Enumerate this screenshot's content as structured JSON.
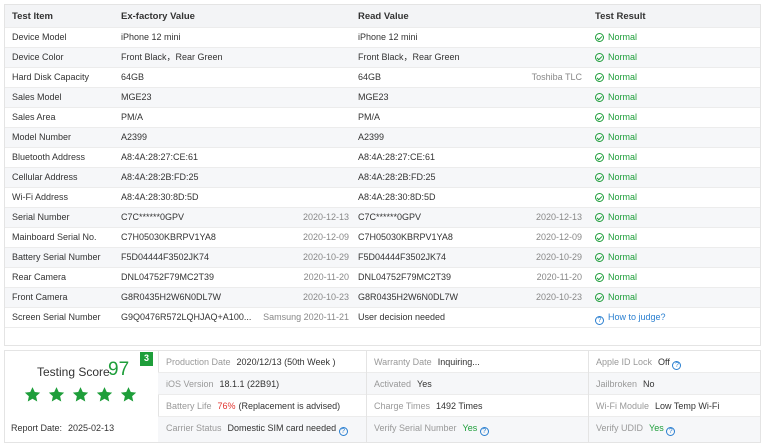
{
  "table": {
    "headers": [
      "Test Item",
      "Ex-factory Value",
      "Read Value",
      "Test Result"
    ],
    "rows": [
      {
        "item": "Device Model",
        "factory": "iPhone 12 mini",
        "factory_sub": "",
        "read": "iPhone 12 mini",
        "read_sub": "",
        "result": "Normal"
      },
      {
        "item": "Device Color",
        "factory": "Front Black，Rear Green",
        "factory_sub": "",
        "read": "Front Black，Rear Green",
        "read_sub": "",
        "result": "Normal"
      },
      {
        "item": "Hard Disk Capacity",
        "factory": "64GB",
        "factory_sub": "",
        "read": "64GB",
        "read_sub": "Toshiba TLC",
        "result": "Normal"
      },
      {
        "item": "Sales Model",
        "factory": "MGE23",
        "factory_sub": "",
        "read": "MGE23",
        "read_sub": "",
        "result": "Normal"
      },
      {
        "item": "Sales Area",
        "factory": "PM/A",
        "factory_sub": "",
        "read": "PM/A",
        "read_sub": "",
        "result": "Normal"
      },
      {
        "item": "Model Number",
        "factory": "A2399",
        "factory_sub": "",
        "read": "A2399",
        "read_sub": "",
        "result": "Normal"
      },
      {
        "item": "Bluetooth Address",
        "factory": "A8:4A:28:27:CE:61",
        "factory_sub": "",
        "read": "A8:4A:28:27:CE:61",
        "read_sub": "",
        "result": "Normal"
      },
      {
        "item": "Cellular Address",
        "factory": "A8:4A:28:2B:FD:25",
        "factory_sub": "",
        "read": "A8:4A:28:2B:FD:25",
        "read_sub": "",
        "result": "Normal"
      },
      {
        "item": "Wi-Fi Address",
        "factory": "A8:4A:28:30:8D:5D",
        "factory_sub": "",
        "read": "A8:4A:28:30:8D:5D",
        "read_sub": "",
        "result": "Normal"
      },
      {
        "item": "Serial Number",
        "factory": "C7C******0GPV",
        "factory_sub": "2020-12-13",
        "read": "C7C******0GPV",
        "read_sub": "2020-12-13",
        "result": "Normal"
      },
      {
        "item": "Mainboard Serial No.",
        "factory": "C7H05030KBRPV1YA8",
        "factory_sub": "2020-12-09",
        "read": "C7H05030KBRPV1YA8",
        "read_sub": "2020-12-09",
        "result": "Normal"
      },
      {
        "item": "Battery Serial Number",
        "factory": "F5D04444F3502JK74",
        "factory_sub": "2020-10-29",
        "read": "F5D04444F3502JK74",
        "read_sub": "2020-10-29",
        "result": "Normal"
      },
      {
        "item": "Rear Camera",
        "factory": "DNL04752F79MC2T39",
        "factory_sub": "2020-11-20",
        "read": "DNL04752F79MC2T39",
        "read_sub": "2020-11-20",
        "result": "Normal"
      },
      {
        "item": "Front Camera",
        "factory": "G8R0435H2W6N0DL7W",
        "factory_sub": "2020-10-23",
        "read": "G8R0435H2W6N0DL7W",
        "read_sub": "2020-10-23",
        "result": "Normal"
      },
      {
        "item": "Screen Serial Number",
        "factory": "G9Q0476R572LQHJAQ+A100...",
        "factory_sub": "Samsung 2020-11-21",
        "read": "User decision needed",
        "read_sub": "",
        "result": "How to judge?"
      }
    ]
  },
  "score": {
    "title": "Testing Score",
    "value": "97",
    "badge": "3",
    "stars": 5,
    "report_label": "Report Date:",
    "report_date": "2025-02-13"
  },
  "info": {
    "production_date": {
      "label": "Production Date",
      "value": "2020/12/13 (50th Week )"
    },
    "warranty_date": {
      "label": "Warranty Date",
      "value": "Inquiring..."
    },
    "apple_id_lock": {
      "label": "Apple ID Lock",
      "value": "Off"
    },
    "ios_version": {
      "label": "iOS Version",
      "value": "18.1.1 (22B91)"
    },
    "activated": {
      "label": "Activated",
      "value": "Yes"
    },
    "jailbroken": {
      "label": "Jailbroken",
      "value": "No"
    },
    "battery_life": {
      "label": "Battery Life",
      "value": "76%",
      "note": "(Replacement is advised)"
    },
    "charge_times": {
      "label": "Charge Times",
      "value": "1492 Times"
    },
    "wifi_module": {
      "label": "Wi-Fi Module",
      "value": "Low Temp Wi-Fi"
    },
    "carrier_status": {
      "label": "Carrier Status",
      "value": "Domestic SIM card needed"
    },
    "verify_serial": {
      "label": "Verify Serial Number",
      "value": "Yes"
    },
    "verify_udid": {
      "label": "Verify UDID",
      "value": "Yes"
    }
  },
  "colors": {
    "green": "#1e9e3a",
    "red": "#e0342f",
    "blue": "#2a7fd0"
  }
}
